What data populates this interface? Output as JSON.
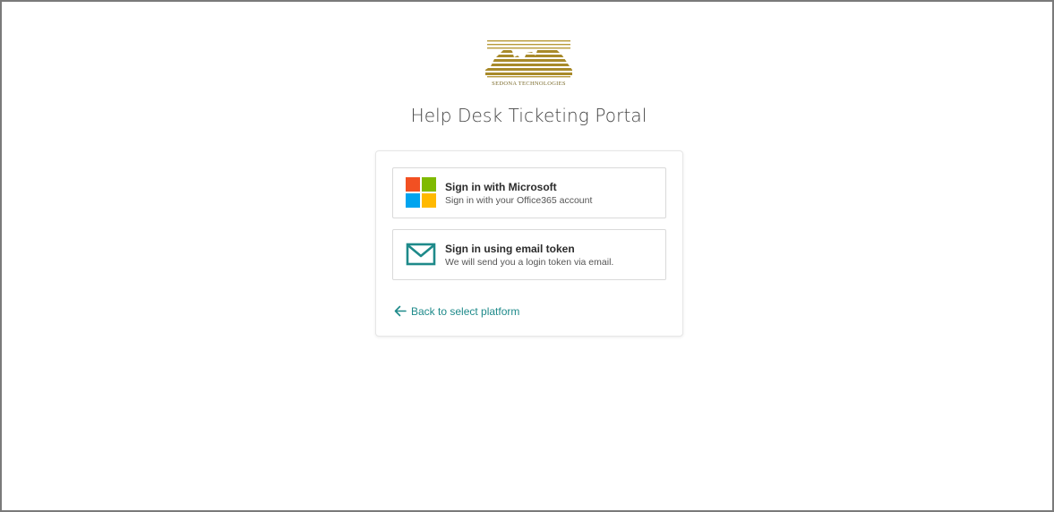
{
  "brand": {
    "logo_text": "SEDONA TECHNOLOGIES",
    "logo_color": "#b89a3a"
  },
  "page": {
    "title": "Help Desk Ticketing Portal"
  },
  "signin_options": [
    {
      "title": "Sign in with Microsoft",
      "subtitle": "Sign in with your Office365 account",
      "icon": "microsoft-logo-icon"
    },
    {
      "title": "Sign in using email token",
      "subtitle": "We will send you a login token via email.",
      "icon": "envelope-icon"
    }
  ],
  "back_link": {
    "label": "Back to select platform",
    "icon": "arrow-left-icon"
  },
  "colors": {
    "accent": "#1e8a8a",
    "ms_red": "#f25022",
    "ms_green": "#7fba00",
    "ms_blue": "#00a4ef",
    "ms_yellow": "#ffb900"
  }
}
